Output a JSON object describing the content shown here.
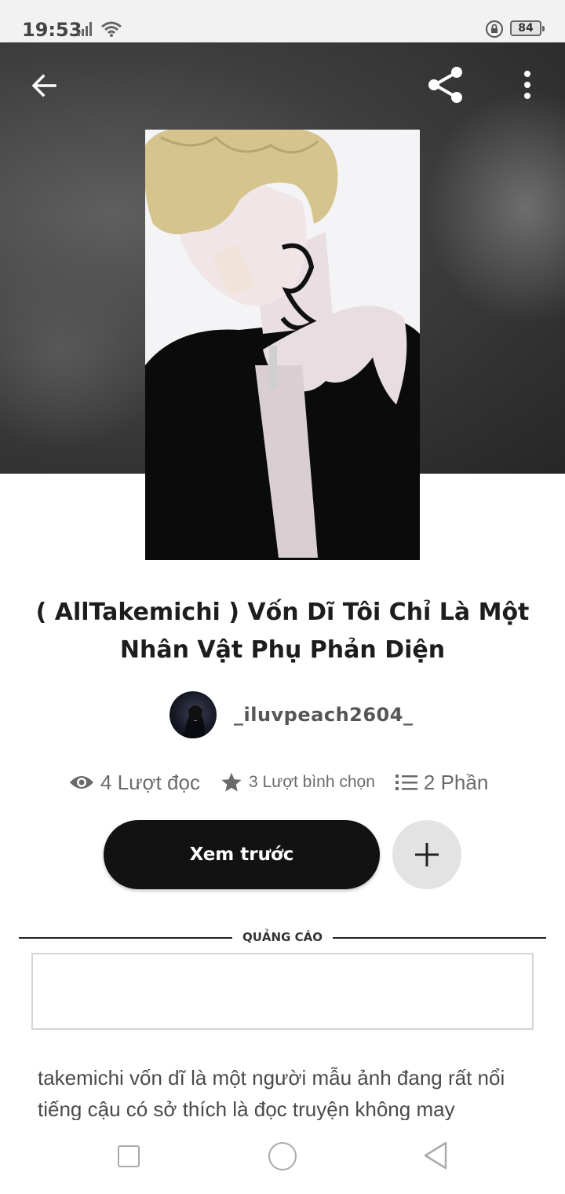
{
  "status_bar": {
    "time": "19:53",
    "battery": "84"
  },
  "header": {
    "back_icon": "arrow-left-icon",
    "share_icon": "share-icon",
    "more_icon": "more-vertical-icon"
  },
  "story": {
    "cover_alt": "cover-image",
    "title": "( AllTakemichi ) Vốn Dĩ Tôi Chỉ Là Một Nhân Vật Phụ Phản Diện",
    "author": "_iluvpeach2604_",
    "stats": {
      "reads": "4 Lượt đọc",
      "votes": "3 Lượt bình chọn",
      "parts": "2 Phần"
    },
    "preview_label": "Xem trước",
    "description": "takemichi vốn dĩ là một người mẫu ảnh đang rất nổi tiếng cậu có sở thích là đọc truyện không may"
  },
  "ad": {
    "label": "QUẢNG CÁO"
  },
  "colors": {
    "primary_button": "#121212",
    "secondary_button": "#e3e3e3",
    "hero_background": "#3e3e3e"
  }
}
